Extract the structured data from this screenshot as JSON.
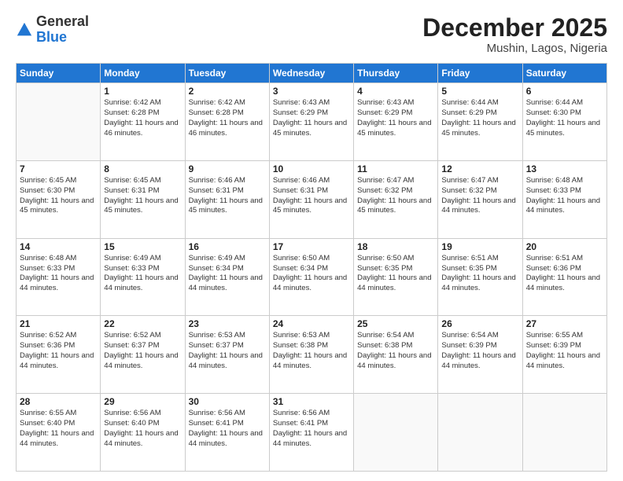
{
  "logo": {
    "general": "General",
    "blue": "Blue"
  },
  "header": {
    "month": "December 2025",
    "location": "Mushin, Lagos, Nigeria"
  },
  "weekdays": [
    "Sunday",
    "Monday",
    "Tuesday",
    "Wednesday",
    "Thursday",
    "Friday",
    "Saturday"
  ],
  "weeks": [
    [
      {
        "day": "",
        "sunrise": "",
        "sunset": "",
        "daylight": "",
        "empty": true
      },
      {
        "day": "1",
        "sunrise": "Sunrise: 6:42 AM",
        "sunset": "Sunset: 6:28 PM",
        "daylight": "Daylight: 11 hours and 46 minutes."
      },
      {
        "day": "2",
        "sunrise": "Sunrise: 6:42 AM",
        "sunset": "Sunset: 6:28 PM",
        "daylight": "Daylight: 11 hours and 46 minutes."
      },
      {
        "day": "3",
        "sunrise": "Sunrise: 6:43 AM",
        "sunset": "Sunset: 6:29 PM",
        "daylight": "Daylight: 11 hours and 45 minutes."
      },
      {
        "day": "4",
        "sunrise": "Sunrise: 6:43 AM",
        "sunset": "Sunset: 6:29 PM",
        "daylight": "Daylight: 11 hours and 45 minutes."
      },
      {
        "day": "5",
        "sunrise": "Sunrise: 6:44 AM",
        "sunset": "Sunset: 6:29 PM",
        "daylight": "Daylight: 11 hours and 45 minutes."
      },
      {
        "day": "6",
        "sunrise": "Sunrise: 6:44 AM",
        "sunset": "Sunset: 6:30 PM",
        "daylight": "Daylight: 11 hours and 45 minutes."
      }
    ],
    [
      {
        "day": "7",
        "sunrise": "Sunrise: 6:45 AM",
        "sunset": "Sunset: 6:30 PM",
        "daylight": "Daylight: 11 hours and 45 minutes."
      },
      {
        "day": "8",
        "sunrise": "Sunrise: 6:45 AM",
        "sunset": "Sunset: 6:31 PM",
        "daylight": "Daylight: 11 hours and 45 minutes."
      },
      {
        "day": "9",
        "sunrise": "Sunrise: 6:46 AM",
        "sunset": "Sunset: 6:31 PM",
        "daylight": "Daylight: 11 hours and 45 minutes."
      },
      {
        "day": "10",
        "sunrise": "Sunrise: 6:46 AM",
        "sunset": "Sunset: 6:31 PM",
        "daylight": "Daylight: 11 hours and 45 minutes."
      },
      {
        "day": "11",
        "sunrise": "Sunrise: 6:47 AM",
        "sunset": "Sunset: 6:32 PM",
        "daylight": "Daylight: 11 hours and 45 minutes."
      },
      {
        "day": "12",
        "sunrise": "Sunrise: 6:47 AM",
        "sunset": "Sunset: 6:32 PM",
        "daylight": "Daylight: 11 hours and 44 minutes."
      },
      {
        "day": "13",
        "sunrise": "Sunrise: 6:48 AM",
        "sunset": "Sunset: 6:33 PM",
        "daylight": "Daylight: 11 hours and 44 minutes."
      }
    ],
    [
      {
        "day": "14",
        "sunrise": "Sunrise: 6:48 AM",
        "sunset": "Sunset: 6:33 PM",
        "daylight": "Daylight: 11 hours and 44 minutes."
      },
      {
        "day": "15",
        "sunrise": "Sunrise: 6:49 AM",
        "sunset": "Sunset: 6:33 PM",
        "daylight": "Daylight: 11 hours and 44 minutes."
      },
      {
        "day": "16",
        "sunrise": "Sunrise: 6:49 AM",
        "sunset": "Sunset: 6:34 PM",
        "daylight": "Daylight: 11 hours and 44 minutes."
      },
      {
        "day": "17",
        "sunrise": "Sunrise: 6:50 AM",
        "sunset": "Sunset: 6:34 PM",
        "daylight": "Daylight: 11 hours and 44 minutes."
      },
      {
        "day": "18",
        "sunrise": "Sunrise: 6:50 AM",
        "sunset": "Sunset: 6:35 PM",
        "daylight": "Daylight: 11 hours and 44 minutes."
      },
      {
        "day": "19",
        "sunrise": "Sunrise: 6:51 AM",
        "sunset": "Sunset: 6:35 PM",
        "daylight": "Daylight: 11 hours and 44 minutes."
      },
      {
        "day": "20",
        "sunrise": "Sunrise: 6:51 AM",
        "sunset": "Sunset: 6:36 PM",
        "daylight": "Daylight: 11 hours and 44 minutes."
      }
    ],
    [
      {
        "day": "21",
        "sunrise": "Sunrise: 6:52 AM",
        "sunset": "Sunset: 6:36 PM",
        "daylight": "Daylight: 11 hours and 44 minutes."
      },
      {
        "day": "22",
        "sunrise": "Sunrise: 6:52 AM",
        "sunset": "Sunset: 6:37 PM",
        "daylight": "Daylight: 11 hours and 44 minutes."
      },
      {
        "day": "23",
        "sunrise": "Sunrise: 6:53 AM",
        "sunset": "Sunset: 6:37 PM",
        "daylight": "Daylight: 11 hours and 44 minutes."
      },
      {
        "day": "24",
        "sunrise": "Sunrise: 6:53 AM",
        "sunset": "Sunset: 6:38 PM",
        "daylight": "Daylight: 11 hours and 44 minutes."
      },
      {
        "day": "25",
        "sunrise": "Sunrise: 6:54 AM",
        "sunset": "Sunset: 6:38 PM",
        "daylight": "Daylight: 11 hours and 44 minutes."
      },
      {
        "day": "26",
        "sunrise": "Sunrise: 6:54 AM",
        "sunset": "Sunset: 6:39 PM",
        "daylight": "Daylight: 11 hours and 44 minutes."
      },
      {
        "day": "27",
        "sunrise": "Sunrise: 6:55 AM",
        "sunset": "Sunset: 6:39 PM",
        "daylight": "Daylight: 11 hours and 44 minutes."
      }
    ],
    [
      {
        "day": "28",
        "sunrise": "Sunrise: 6:55 AM",
        "sunset": "Sunset: 6:40 PM",
        "daylight": "Daylight: 11 hours and 44 minutes."
      },
      {
        "day": "29",
        "sunrise": "Sunrise: 6:56 AM",
        "sunset": "Sunset: 6:40 PM",
        "daylight": "Daylight: 11 hours and 44 minutes."
      },
      {
        "day": "30",
        "sunrise": "Sunrise: 6:56 AM",
        "sunset": "Sunset: 6:41 PM",
        "daylight": "Daylight: 11 hours and 44 minutes."
      },
      {
        "day": "31",
        "sunrise": "Sunrise: 6:56 AM",
        "sunset": "Sunset: 6:41 PM",
        "daylight": "Daylight: 11 hours and 44 minutes."
      },
      {
        "day": "",
        "sunrise": "",
        "sunset": "",
        "daylight": "",
        "empty": true
      },
      {
        "day": "",
        "sunrise": "",
        "sunset": "",
        "daylight": "",
        "empty": true
      },
      {
        "day": "",
        "sunrise": "",
        "sunset": "",
        "daylight": "",
        "empty": true
      }
    ]
  ]
}
